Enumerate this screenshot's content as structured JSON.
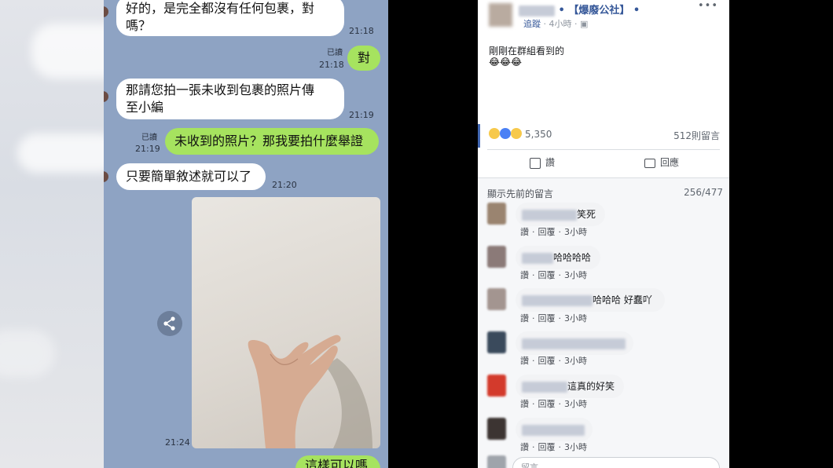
{
  "chat": {
    "messages": [
      {
        "line1": "好的，是完全都沒有任何包裹，對",
        "line2": "嗎？",
        "time": "21:18"
      },
      {
        "text": "對",
        "read": "已讀",
        "time": "21:18"
      },
      {
        "line1": "那請您拍一張未收到包裹的照片傳",
        "line2": "至小編",
        "time": "21:19"
      },
      {
        "text": "未收到的照片？那我要拍什麼舉證",
        "read": "已讀",
        "time": "21:19"
      },
      {
        "text": "只要簡單敘述就可以了",
        "time": "21:20"
      },
      {
        "time": "21:24"
      },
      {
        "text": "這樣可以嗎"
      }
    ]
  },
  "facebook": {
    "page_name": "【爆廢公社】",
    "follow": "追蹤",
    "post_time": "4小時",
    "post_text": "剛剛在群組看到的",
    "post_emoji": "😂😂😂",
    "reaction_count": "5,350",
    "comment_count": "512則留言",
    "like_label": "讚",
    "comment_label": "回應",
    "prev_comments": "顯示先前的留言",
    "comment_page": "256/477",
    "comments": [
      {
        "text": "笑死",
        "like": "讚",
        "reply": "回覆",
        "time": "3小時"
      },
      {
        "text": "哈哈哈哈",
        "like": "讚",
        "reply": "回覆",
        "time": "3小時"
      },
      {
        "text": "哈哈哈 好蠢吖",
        "like": "讚",
        "reply": "回覆",
        "time": "3小時"
      },
      {
        "text": "",
        "like": "讚",
        "reply": "回覆",
        "time": "3小時"
      },
      {
        "text": "這真的好笑",
        "like": "讚",
        "reply": "回覆",
        "time": "3小時"
      },
      {
        "text": "",
        "like": "讚",
        "reply": "回覆",
        "time": "3小時"
      }
    ],
    "comment_placeholder": "留言……",
    "more": "•••"
  },
  "colors": {
    "line_bg": "#8ea3c3",
    "line_green": "#a6e35f",
    "fb_blue": "#365899",
    "fb_border": "#4267b2"
  },
  "icons": [
    "share-icon",
    "more-icon",
    "globe-icon",
    "thumbs-up-icon",
    "comment-icon",
    "haha-icon",
    "like-icon",
    "wow-icon"
  ]
}
